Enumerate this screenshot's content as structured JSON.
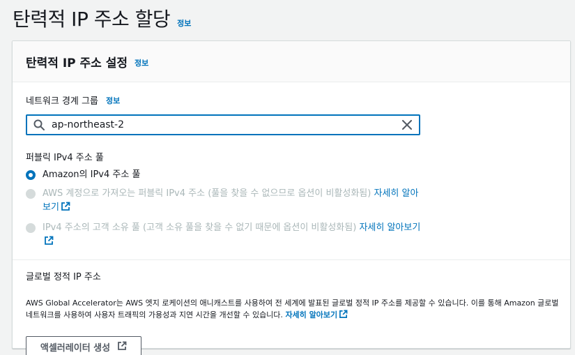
{
  "page": {
    "title": "탄력적 IP 주소 할당",
    "info": "정보"
  },
  "panel": {
    "title": "탄력적 IP 주소 설정",
    "info": "정보"
  },
  "network_border_group": {
    "label": "네트워크 경계 그룹",
    "info": "정보",
    "value": "ap-northeast-2",
    "search_icon": "search-icon",
    "clear_icon": "close-icon"
  },
  "public_pool": {
    "label": "퍼블릭 IPv4 주소 풀",
    "options": [
      {
        "text": "Amazon의 IPv4 주소 풀",
        "selected": true,
        "disabled": false
      },
      {
        "text": "AWS 계정으로 가져오는 퍼블릭 IPv4 주소 (풀을 찾을 수 없으므로 옵션이 비활성화됨)",
        "link_part1": "자세히 알아",
        "link_part2": "보기",
        "selected": false,
        "disabled": true
      },
      {
        "text": "IPv4 주소의 고객 소유 풀 (고객 소유 풀을 찾을 수 없기 때문에 옵션이 비활성화됨)",
        "link": "자세히 알아보기",
        "selected": false,
        "disabled": true
      }
    ]
  },
  "global_static_ip": {
    "title": "글로벌 정적 IP 주소",
    "description": "AWS Global Accelerator는 AWS 엣지 로케이션의 애니캐스트를 사용하여 전 세계에 발표된 글로벌 정적 IP 주소를 제공할 수 있습니다. 이를 통해 Amazon 글로벌 네트워크를 사용하여 사용자 트래픽의 가용성과 지연 시간을 개선할 수 있습니다.",
    "link": "자세히 알아보기",
    "button_label": "액셀러레이터 생성"
  },
  "colors": {
    "accent": "#0073bb",
    "text": "#16191f",
    "disabled": "#aab7b8",
    "background": "#f2f3f3"
  }
}
